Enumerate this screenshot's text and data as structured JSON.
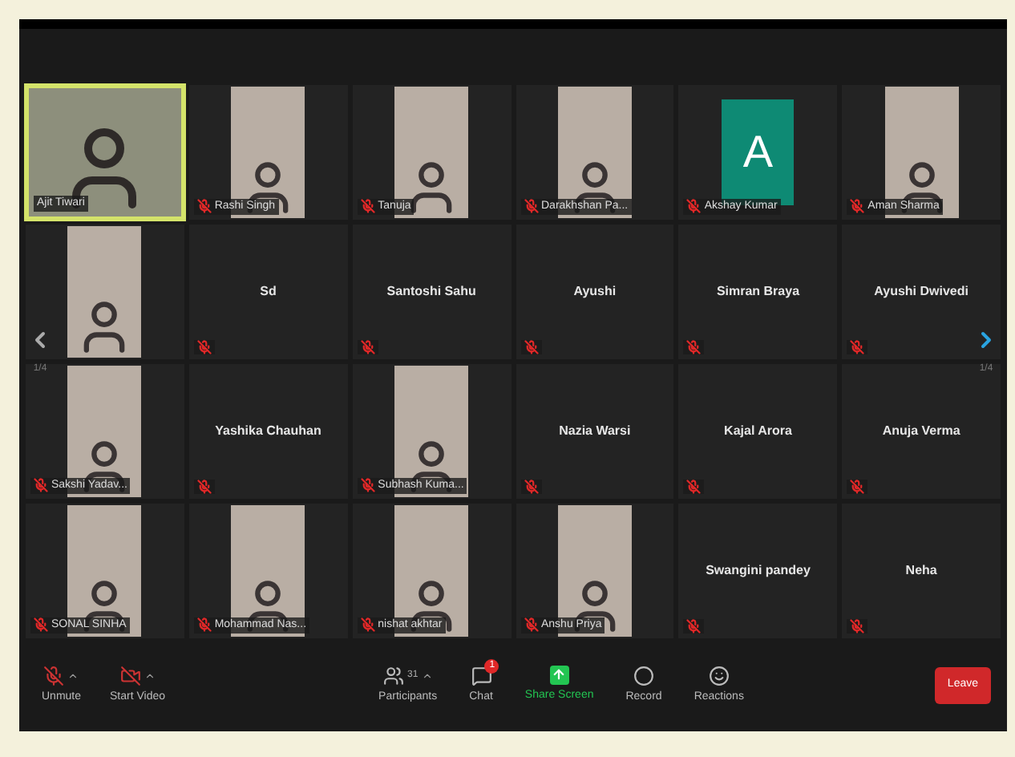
{
  "pager": {
    "left": "1/4",
    "right": "1/4"
  },
  "tiles": [
    {
      "kind": "video",
      "name": "Ajit Tiwari",
      "muted": false,
      "active": true
    },
    {
      "kind": "photo",
      "name": "Rashi Singh",
      "muted": true,
      "active": false
    },
    {
      "kind": "photo",
      "name": "Tanuja",
      "muted": true,
      "active": false
    },
    {
      "kind": "photo",
      "name": "Darakhshan Pa...",
      "muted": true,
      "active": false
    },
    {
      "kind": "avatar",
      "initial": "A",
      "color": "#0e8a74",
      "name": "Akshay Kumar",
      "muted": true,
      "active": false
    },
    {
      "kind": "photo",
      "name": "Aman Sharma",
      "muted": true,
      "active": false
    },
    {
      "kind": "photo",
      "muted": false,
      "active": false
    },
    {
      "kind": "name",
      "name": "Sd",
      "muted": true,
      "active": false
    },
    {
      "kind": "name",
      "name": "Santoshi Sahu",
      "muted": true,
      "active": false
    },
    {
      "kind": "name",
      "name": "Ayushi",
      "muted": true,
      "active": false
    },
    {
      "kind": "name",
      "name": "Simran Braya",
      "muted": true,
      "active": false
    },
    {
      "kind": "name",
      "name": "Ayushi Dwivedi",
      "muted": true,
      "active": false
    },
    {
      "kind": "photo",
      "name": "Sakshi Yadav...",
      "muted": true,
      "active": false
    },
    {
      "kind": "name",
      "name": "Yashika Chauhan",
      "muted": true,
      "active": false
    },
    {
      "kind": "photo",
      "name": "Subhash Kuma...",
      "muted": true,
      "active": false
    },
    {
      "kind": "name",
      "name": "Nazia Warsi",
      "muted": true,
      "active": false
    },
    {
      "kind": "name",
      "name": "Kajal Arora",
      "muted": true,
      "active": false
    },
    {
      "kind": "name",
      "name": "Anuja Verma",
      "muted": true,
      "active": false
    },
    {
      "kind": "photo",
      "name": "SONAL SINHA",
      "muted": true,
      "active": false
    },
    {
      "kind": "photo",
      "name": "Mohammad Nas...",
      "muted": true,
      "active": false
    },
    {
      "kind": "photo",
      "name": "nishat akhtar",
      "muted": true,
      "active": false
    },
    {
      "kind": "photo",
      "name": "Anshu Priya",
      "muted": true,
      "active": false
    },
    {
      "kind": "name",
      "name": "Swangini pandey",
      "muted": true,
      "active": false
    },
    {
      "kind": "name",
      "name": "Neha",
      "muted": true,
      "active": false
    }
  ],
  "toolbar": {
    "left": [
      {
        "kind": "mic",
        "label": "Unmute"
      },
      {
        "kind": "video",
        "label": "Start Video"
      }
    ],
    "center": [
      {
        "kind": "participants",
        "label": "Participants",
        "count": "31"
      },
      {
        "kind": "chat",
        "label": "Chat",
        "badge": "1"
      },
      {
        "kind": "share",
        "label": "Share Screen"
      },
      {
        "kind": "record",
        "label": "Record"
      },
      {
        "kind": "reactions",
        "label": "Reactions"
      }
    ],
    "leave": "Leave"
  }
}
